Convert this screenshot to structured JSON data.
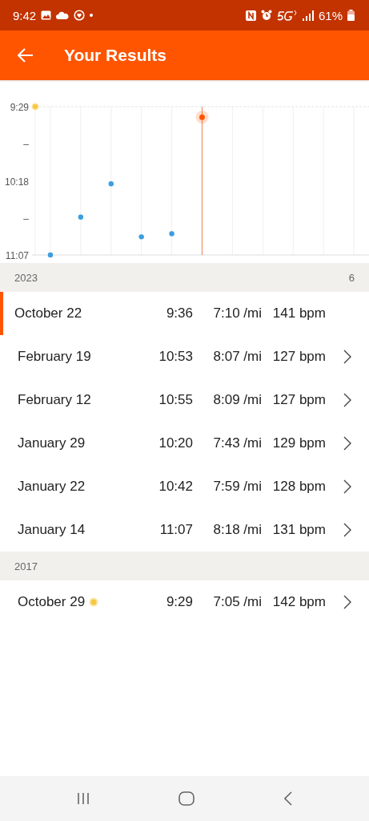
{
  "status_bar": {
    "time": "9:42",
    "battery": "61%"
  },
  "app_bar": {
    "title": "Your Results"
  },
  "chart": {
    "chart_data": {
      "type": "scatter",
      "categories": [
        null,
        null,
        null,
        null,
        null,
        null,
        null,
        null,
        null,
        null,
        null
      ],
      "series": [
        {
          "color": "#3b9ee0",
          "values": [
            667,
            642,
            620,
            655,
            653,
            null,
            null,
            null,
            null,
            null,
            null
          ]
        },
        {
          "color": "#ff5500",
          "values": [
            null,
            null,
            null,
            null,
            null,
            576,
            null,
            null,
            null,
            null,
            null
          ]
        }
      ],
      "grid": true,
      "ylim": [
        667,
        569
      ],
      "yticks": [
        {
          "value": 569,
          "label": "9:29"
        },
        {
          "value": 593.5,
          "label": "–"
        },
        {
          "value": 618,
          "label": "10:18"
        },
        {
          "value": 642.5,
          "label": "–"
        },
        {
          "value": 667,
          "label": "11:07"
        }
      ]
    },
    "points": [
      {
        "selected": false
      },
      {
        "selected": false
      },
      {
        "selected": false
      },
      {
        "selected": false
      },
      {
        "selected": false
      },
      {
        "selected": true
      }
    ]
  },
  "sections": [
    {
      "year": "2023",
      "count": "6",
      "rows": [
        {
          "date": "October 22",
          "record": false,
          "time": "9:36",
          "pace": "7:10 /mi",
          "heart_rate": "141 bpm",
          "selected": true
        },
        {
          "date": "February 19",
          "record": false,
          "time": "10:53",
          "pace": "8:07 /mi",
          "heart_rate": "127 bpm",
          "selected": false
        },
        {
          "date": "February 12",
          "record": false,
          "time": "10:55",
          "pace": "8:09 /mi",
          "heart_rate": "127 bpm",
          "selected": false
        },
        {
          "date": "January 29",
          "record": false,
          "time": "10:20",
          "pace": "7:43 /mi",
          "heart_rate": "129 bpm",
          "selected": false
        },
        {
          "date": "January 22",
          "record": false,
          "time": "10:42",
          "pace": "7:59 /mi",
          "heart_rate": "128 bpm",
          "selected": false
        },
        {
          "date": "January 14",
          "record": false,
          "time": "11:07",
          "pace": "8:18 /mi",
          "heart_rate": "131 bpm",
          "selected": false
        }
      ]
    },
    {
      "year": "2017",
      "rows": [
        {
          "date": "October 29",
          "record": true,
          "time": "9:29",
          "pace": "7:05 /mi",
          "heart_rate": "142 bpm",
          "selected": false
        }
      ]
    }
  ]
}
